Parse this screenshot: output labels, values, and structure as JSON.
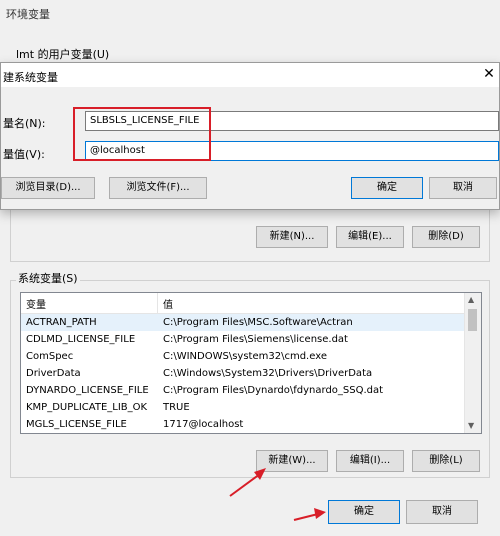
{
  "background_window": {
    "title": "环境变量",
    "user_vars_label": "lmt 的用户变量(U)",
    "user_buttons": {
      "new": "新建(N)...",
      "edit": "编辑(E)...",
      "delete": "删除(D)"
    },
    "system_vars_label": "系统变量(S)",
    "system_table": {
      "headers": [
        "变量",
        "值"
      ],
      "rows": [
        {
          "name": "ACTRAN_PATH",
          "value": "C:\\Program Files\\MSC.Software\\Actran",
          "selected": true
        },
        {
          "name": "CDLMD_LICENSE_FILE",
          "value": "C:\\Program Files\\Siemens\\license.dat"
        },
        {
          "name": "ComSpec",
          "value": "C:\\WINDOWS\\system32\\cmd.exe"
        },
        {
          "name": "DriverData",
          "value": "C:\\Windows\\System32\\Drivers\\DriverData"
        },
        {
          "name": "DYNARDO_LICENSE_FILE",
          "value": "C:\\Program Files\\Dynardo\\fdynardo_SSQ.dat"
        },
        {
          "name": "KMP_DUPLICATE_LIB_OK",
          "value": "TRUE"
        },
        {
          "name": "MGLS_LICENSE_FILE",
          "value": "1717@localhost"
        }
      ]
    },
    "system_buttons": {
      "new": "新建(W)...",
      "edit": "编辑(I)...",
      "delete": "删除(L)"
    },
    "ok": "确定",
    "cancel": "取消"
  },
  "dialog": {
    "title": "建系统变量",
    "name_label": "量名(N):",
    "name_value": "SLBSLS_LICENSE_FILE",
    "value_label": "量值(V):",
    "value_value": "@localhost",
    "browse_dir": "浏览目录(D)...",
    "browse_file": "浏览文件(F)...",
    "ok": "确定",
    "cancel": "取消",
    "close_glyph": "✕"
  },
  "colors": {
    "annotation_red": "#d81e28",
    "focus_blue": "#0078d7"
  }
}
